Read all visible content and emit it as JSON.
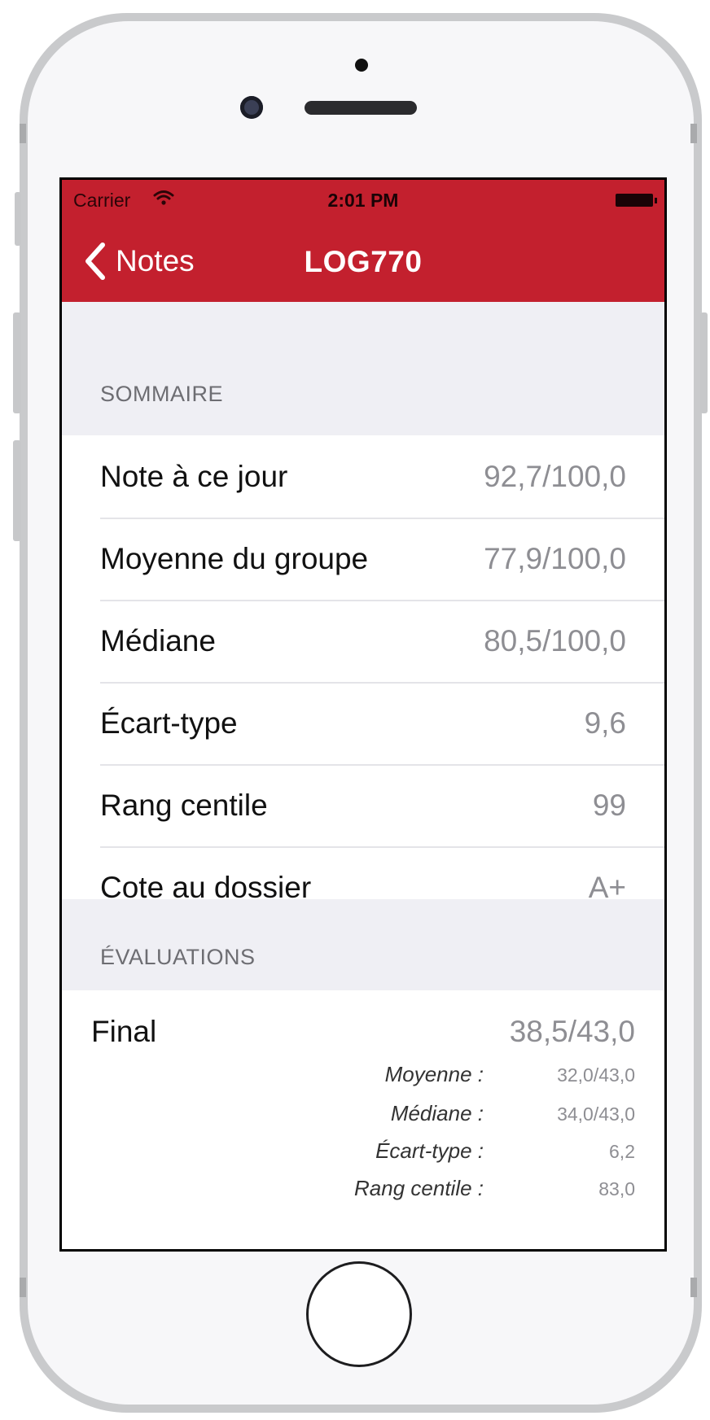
{
  "status_bar": {
    "carrier": "Carrier",
    "time": "2:01 PM"
  },
  "nav": {
    "back_label": "Notes",
    "title": "LOG770",
    "bar_color": "#c3202e"
  },
  "summary": {
    "header": "SOMMAIRE",
    "rows": [
      {
        "label": "Note à ce jour",
        "value": "92,7/100,0"
      },
      {
        "label": "Moyenne du groupe",
        "value": "77,9/100,0"
      },
      {
        "label": "Médiane",
        "value": "80,5/100,0"
      },
      {
        "label": "Écart-type",
        "value": "9,6"
      },
      {
        "label": "Rang centile",
        "value": "99"
      },
      {
        "label": "Cote au dossier",
        "value": "A+"
      }
    ]
  },
  "evaluations": {
    "header": "ÉVALUATIONS",
    "items": [
      {
        "name": "Final",
        "score": "38,5/43,0",
        "stats": [
          {
            "label": "Moyenne :",
            "value": "32,0/43,0"
          },
          {
            "label": "Médiane :",
            "value": "34,0/43,0"
          },
          {
            "label": "Écart-type :",
            "value": "6,2"
          },
          {
            "label": "Rang centile :",
            "value": "83,0"
          }
        ]
      }
    ]
  },
  "icons": {
    "back": "chevron-left-icon",
    "wifi": "wifi-icon",
    "battery": "battery-icon"
  }
}
